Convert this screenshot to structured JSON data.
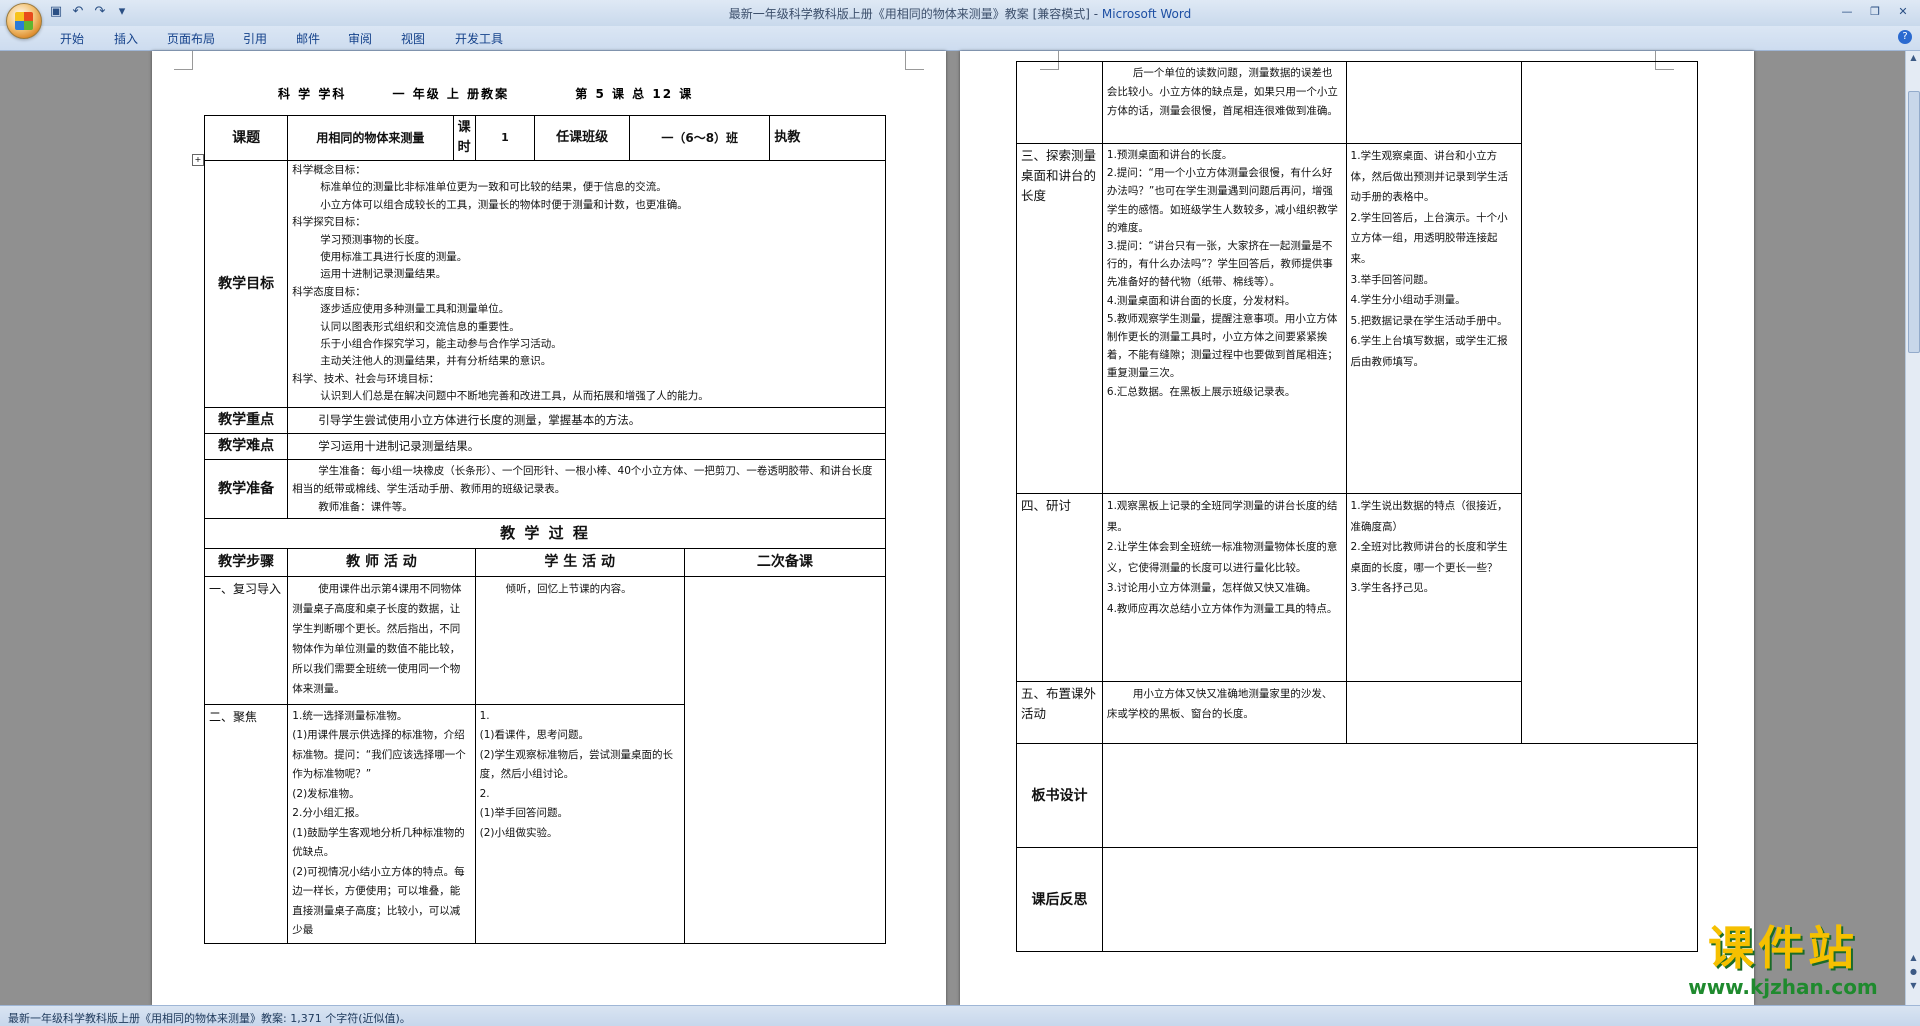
{
  "window": {
    "title": "最新一年级科学教科版上册《用相同的物体来测量》教案 [兼容模式] - Microsoft Word",
    "title_doc": "最新一年级科学教科版上册《用相同的物体来测量》教案 [兼容模式] - ",
    "title_app": "Microsoft Word"
  },
  "qat": {
    "save_icon": "save-icon",
    "undo_icon": "undo-icon",
    "redo_icon": "redo-icon",
    "customize_icon": "chevron-down-icon"
  },
  "ribbon": {
    "tabs": [
      "开始",
      "插入",
      "页面布局",
      "引用",
      "邮件",
      "审阅",
      "视图",
      "开发工具"
    ]
  },
  "status": {
    "text": "最新一年级科学教科版上册《用相同的物体来测量》教案: 1,371 个字符(近似值)。"
  },
  "doc": {
    "header": {
      "subject": "科 学 学科",
      "grade": "一 年级 上 册教案",
      "lesson": "第 5 课 总 12 课"
    },
    "info": {
      "topic_label": "课题",
      "topic": "用相同的物体来测量",
      "hours_label": "课时",
      "hours": "1",
      "class_label": "任课班级",
      "class": "一（6～8）班",
      "teacher_label": "执教"
    },
    "goals": {
      "label": "教学目标",
      "lines": [
        "科学概念目标：",
        "标准单位的测量比非标准单位更为一致和可比较的结果，便于信息的交流。",
        "小立方体可以组合成较长的工具，测量长的物体时便于测量和计数，也更准确。",
        "科学探究目标：",
        "学习预测事物的长度。",
        "使用标准工具进行长度的测量。",
        "运用十进制记录测量结果。",
        "科学态度目标：",
        "逐步适应使用多种测量工具和测量单位。",
        "认同以图表形式组织和交流信息的重要性。",
        "乐于小组合作探究学习，能主动参与合作学习活动。",
        "主动关注他人的测量结果，并有分析结果的意识。",
        "科学、技术、社会与环境目标：",
        "认识到人们总是在解决问题中不断地完善和改进工具，从而拓展和增强了人的能力。"
      ]
    },
    "key": {
      "label": "教学重点",
      "text": "引导学生尝试使用小立方体进行长度的测量，掌握基本的方法。"
    },
    "difficult": {
      "label": "教学难点",
      "text": "学习运用十进制记录测量结果。"
    },
    "prep": {
      "label": "教学准备",
      "text": "学生准备：每小组一块橡皮（长条形）、一个回形针、一根小棒、40个小立方体、一把剪刀、一卷透明胶带、和讲台长度相当的纸带或棉线、学生活动手册、教师用的班级记录表。",
      "text2": "教师准备：课件等。"
    },
    "process_title": "教 学 过 程",
    "cols": {
      "step": "教学步骤",
      "teacher": "教 师 活 动",
      "student": "学 生 活 动",
      "second": "二次备课"
    },
    "steps_p1": [
      {
        "name": "一、复习导入",
        "teacher": "使用课件出示第4课用不同物体测量桌子高度和桌子长度的数据，让学生判断哪个更长。然后指出，不同物体作为单位测量的数值不能比较，所以我们需要全班统一使用同一个物体来测量。",
        "student": "倾听，回忆上节课的内容。"
      },
      {
        "name": "二、聚焦",
        "teacher": "1.统一选择测量标准物。\n(1)用课件展示供选择的标准物，介绍标准物。提问：“我们应该选择哪一个作为标准物呢？”\n(2)发标准物。\n2.分小组汇报。\n(1)鼓励学生客观地分析几种标准物的优缺点。\n(2)可视情况小结小立方体的特点。每边一样长，方便使用；可以堆叠，能直接测量桌子高度；比较小，可以减少最",
        "student": "1.\n(1)看课件，思考问题。\n(2)学生观察标准物后，尝试测量桌面的长度，然后小组讨论。\n2.\n(1)举手回答问题。\n(2)小组做实验。"
      }
    ],
    "steps_p2": [
      {
        "name": "",
        "teacher": "后一个单位的读数问题，测量数据的误差也会比较小。小立方体的缺点是，如果只用一个小立方体的话，测量会很慢，首尾相连很难做到准确。",
        "student": ""
      },
      {
        "name": "三、探索测量桌面和讲台的长度",
        "teacher": "1.预测桌面和讲台的长度。\n2.提问：“用一个小立方体测量会很慢，有什么好办法吗？”也可在学生测量遇到问题后再问，增强学生的感悟。如班级学生人数较多，减小组织教学的难度。\n3.提问：“讲台只有一张，大家挤在一起测量是不行的，有什么办法吗”？学生回答后，教师提供事先准备好的替代物（纸带、棉线等）。\n4.测量桌面和讲台面的长度，分发材料。\n5.教师观察学生测量，提醒注意事项。用小立方体制作更长的测量工具时，小立方体之间要紧紧挨着，不能有缝隙；测量过程中也要做到首尾相连；重复测量三次。\n6.汇总数据。在黑板上展示班级记录表。",
        "student": "1.学生观察桌面、讲台和小立方体，然后做出预测并记录到学生活动手册的表格中。\n2.学生回答后，上台演示。十个小立方体一组，用透明胶带连接起来。\n3.举手回答问题。\n4.学生分小组动手测量。\n5.把数据记录在学生活动手册中。\n6.学生上台填写数据，或学生汇报后由教师填写。"
      },
      {
        "name": "四、研讨",
        "teacher": "1.观察黑板上记录的全班同学测量的讲台长度的结果。\n2.让学生体会到全班统一标准物测量物体长度的意义，它使得测量的长度可以进行量化比较。\n3.讨论用小立方体测量，怎样做又快又准确。\n4.教师应再次总结小立方体作为测量工具的特点。",
        "student": "1.学生说出数据的特点（很接近，准确度高）\n2.全班对比教师讲台的长度和学生桌面的长度，哪一个更长一些？\n3.学生各抒己见。"
      },
      {
        "name": "五、布置课外活动",
        "teacher": "用小立方体又快又准确地测量家里的沙发、床或学校的黑板、窗台的长度。",
        "student": ""
      }
    ],
    "board_label": "板书设计",
    "reflection_label": "课后反思"
  },
  "watermark": {
    "big": "课件站",
    "url": "www.kjzhan.com"
  }
}
